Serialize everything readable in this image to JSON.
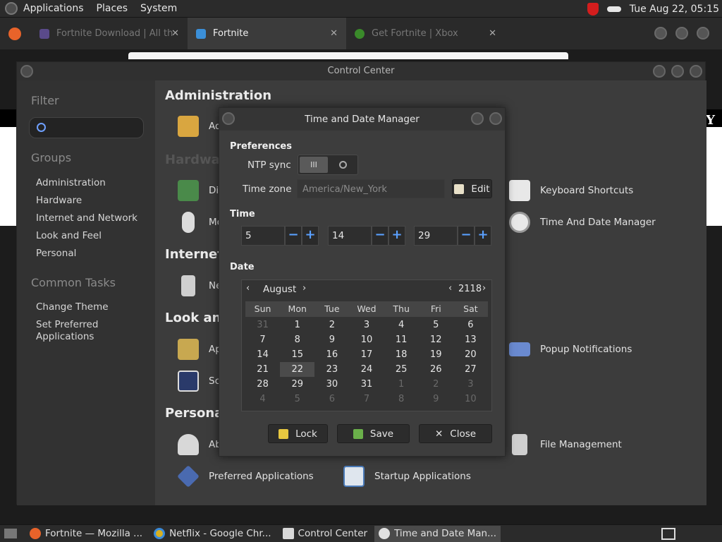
{
  "top_panel": {
    "menus": [
      "Applications",
      "Places",
      "System"
    ],
    "clock": "Tue Aug 22, 05:15"
  },
  "browser": {
    "tabs": [
      {
        "label": "Fortnite Download | All th"
      },
      {
        "label": "Fortnite"
      },
      {
        "label": "Get Fortnite | Xbox"
      }
    ],
    "page_letter": "Y"
  },
  "control_center": {
    "title": "Control Center",
    "filter_label": "Filter",
    "groups_label": "Groups",
    "groups": [
      "Administration",
      "Hardware",
      "Internet and Network",
      "Look and Feel",
      "Personal"
    ],
    "common_tasks_label": "Common Tasks",
    "tasks": [
      "Change Theme",
      "Set Preferred Applications"
    ],
    "sections": {
      "administration": "Administration",
      "hardware": "Hardware",
      "internet": "Internet a",
      "look": "Look and",
      "personal": "Personal"
    },
    "items": {
      "admin_partial": "Ad",
      "display_partial": "Dis",
      "mouse_partial": "Mo",
      "network_partial": "Ne",
      "appearance_partial": "Ap",
      "screensaver_partial": "Scr",
      "about_partial": "Ab",
      "keyboard_shortcuts": "Keyboard Shortcuts",
      "time_date_manager": "Time And Date Manager",
      "popup_notifications": "Popup Notifications",
      "file_management": "File Management",
      "preferred_applications": "Preferred Applications",
      "startup_applications": "Startup Applications"
    }
  },
  "tdm": {
    "title": "Time and Date Manager",
    "preferences_label": "Preferences",
    "ntp_label": "NTP sync",
    "ntp_on_glyph": "III",
    "timezone_label": "Time zone",
    "timezone_value": "America/New_York",
    "edit_label": "Edit",
    "time_label": "Time",
    "hours": "5",
    "minutes": "14",
    "seconds": "29",
    "minus": "−",
    "plus": "+",
    "date_label": "Date",
    "calendar": {
      "prev": "‹",
      "next": "›",
      "month": "August",
      "year": "2118",
      "weekdays": [
        "Sun",
        "Mon",
        "Tue",
        "Wed",
        "Thu",
        "Fri",
        "Sat"
      ],
      "weeks": [
        [
          "31",
          "1",
          "2",
          "3",
          "4",
          "5",
          "6"
        ],
        [
          "7",
          "8",
          "9",
          "10",
          "11",
          "12",
          "13"
        ],
        [
          "14",
          "15",
          "16",
          "17",
          "18",
          "19",
          "20"
        ],
        [
          "21",
          "22",
          "23",
          "24",
          "25",
          "26",
          "27"
        ],
        [
          "28",
          "29",
          "30",
          "31",
          "1",
          "2",
          "3"
        ],
        [
          "4",
          "5",
          "6",
          "7",
          "8",
          "9",
          "10"
        ]
      ],
      "selected": "22"
    },
    "lock_label": "Lock",
    "save_label": "Save",
    "close_label": "Close"
  },
  "taskbar": {
    "tasks": [
      {
        "label": "Fortnite — Mozilla ..."
      },
      {
        "label": "Netflix - Google Chr..."
      },
      {
        "label": "Control Center"
      },
      {
        "label": "Time and Date Man..."
      }
    ]
  },
  "colors": {
    "accent_blue": "#5aa0ff",
    "shield_red": "#d31d1d"
  }
}
